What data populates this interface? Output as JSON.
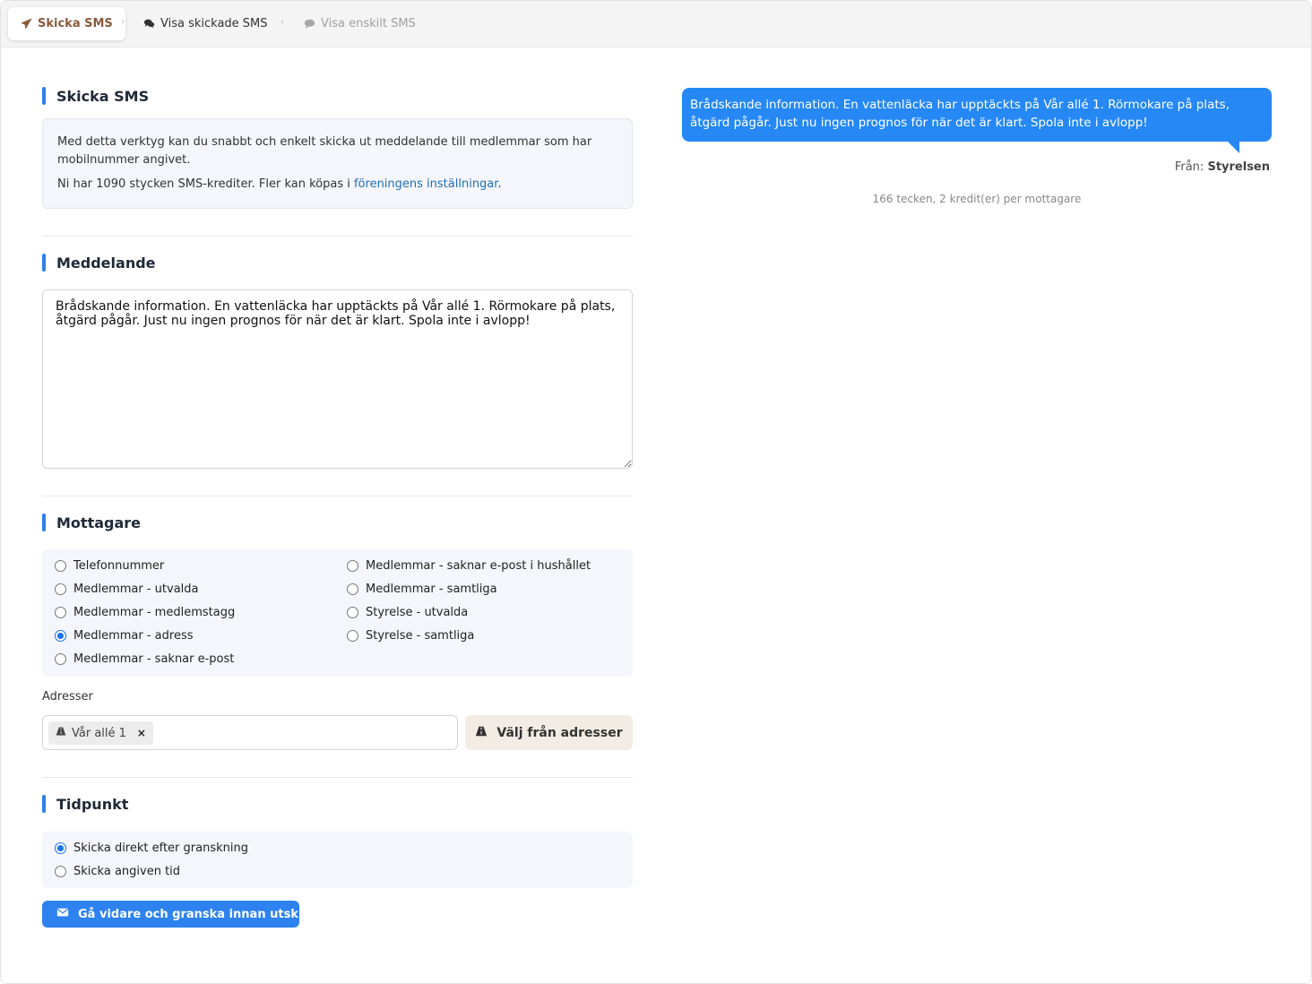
{
  "breadcrumb": {
    "tab1": "Skicka SMS",
    "tab2": "Visa skickade SMS",
    "tab3": "Visa enskilt SMS",
    "separator": "›"
  },
  "info": {
    "title": "Skicka SMS",
    "line1": "Med detta verktyg kan du snabbt och enkelt skicka ut meddelande till medlemmar som har mobilnummer angivet.",
    "line2_prefix": "Ni har 1090 stycken SMS-krediter. Fler kan köpas i ",
    "link": "föreningens inställningar",
    "line2_suffix": "."
  },
  "message": {
    "title": "Meddelande",
    "text": "Brådskande information. En vattenläcka har upptäckts på Vår allé 1. Rörmokare på plats, åtgärd pågår. Just nu ingen prognos för när det är klart. Spola inte i avlopp!"
  },
  "recipients": {
    "title": "Mottagare",
    "options": [
      "Telefonnummer",
      "Medlemmar - utvalda",
      "Medlemmar - medlemstagg",
      "Medlemmar - adress",
      "Medlemmar - saknar e-post",
      "Medlemmar - saknar e-post i hushållet",
      "Medlemmar - samtliga",
      "Styrelse - utvalda",
      "Styrelse - samtliga"
    ],
    "selected": "Medlemmar - adress",
    "addresses_label": "Adresser",
    "tag": "Vår allé 1",
    "tag_remove": "×",
    "choose_button": "Välj från adresser"
  },
  "timing": {
    "title": "Tidpunkt",
    "options": [
      "Skicka direkt efter granskning",
      "Skicka angiven tid"
    ],
    "selected": "Skicka direkt efter granskning"
  },
  "submit_label": "Gå vidare och granska innan utskick",
  "preview": {
    "text": "Brådskande information. En vattenläcka har upptäckts på Vår allé 1. Rörmokare på plats, åtgärd pågår. Just nu ingen prognos för när det är klart. Spola inte i avlopp!",
    "from_label": "Från:",
    "from_name": "Styrelsen",
    "counter": "166 tecken, 2 kredit(er) per mottagare"
  },
  "colors": {
    "accent": "#2f7fe6",
    "bubble": "#2588f5",
    "active_tab_text": "#8a5a3c"
  },
  "icons": {
    "tab1": "paper-plane-icon",
    "tab2": "comments-icon",
    "tab3": "comment-icon",
    "road": "road-icon",
    "envelope": "envelope-icon"
  }
}
